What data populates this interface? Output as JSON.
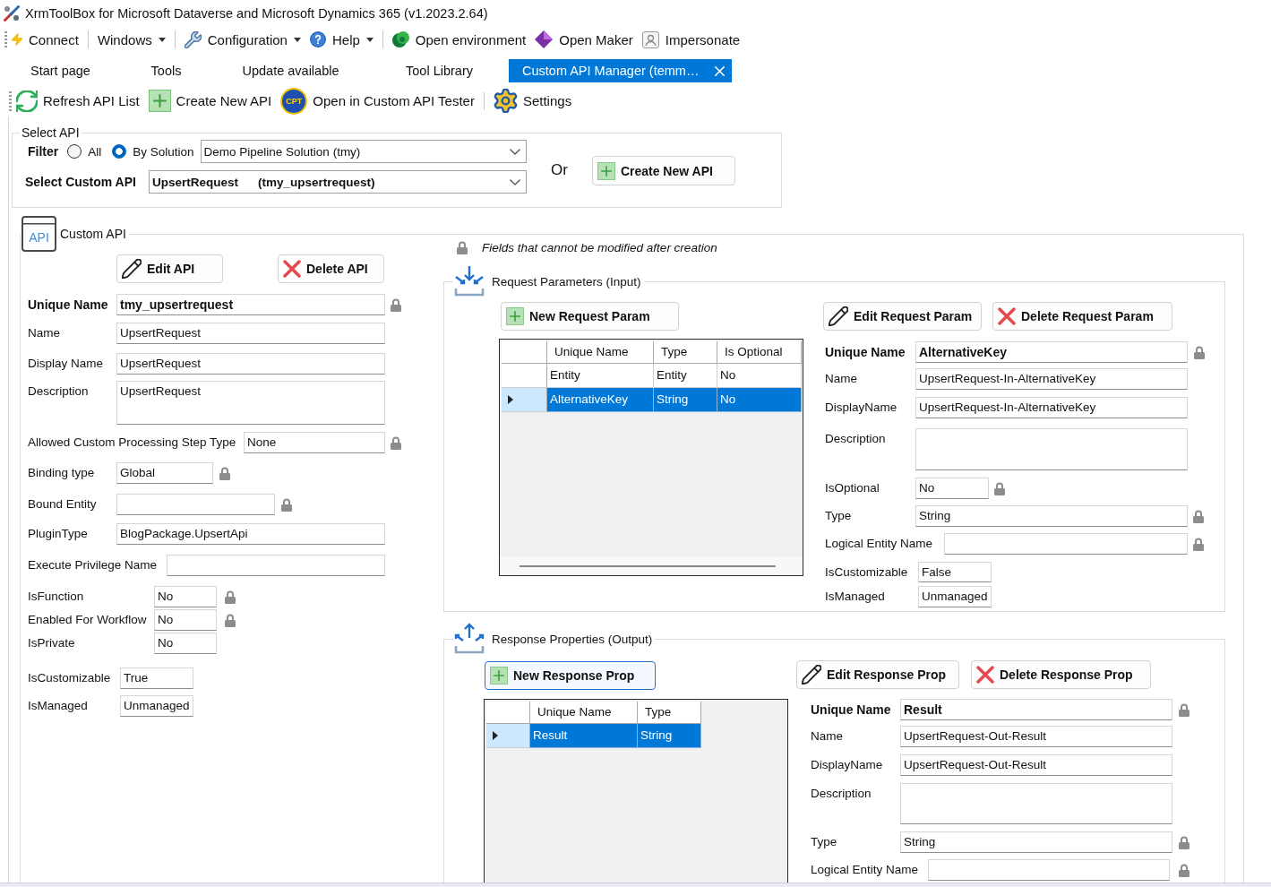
{
  "window": {
    "title": "XrmToolBox for Microsoft Dataverse and Microsoft Dynamics 365 (v1.2023.2.64)"
  },
  "menu_bar": {
    "groups": [
      {
        "items": [
          {
            "label": "Connect",
            "dropdown": false
          }
        ]
      },
      {
        "items": [
          {
            "label": "Windows",
            "dropdown": true
          }
        ]
      },
      {
        "items": [
          {
            "label": "Configuration",
            "dropdown": true
          },
          {
            "label": "Help",
            "dropdown": true
          }
        ]
      },
      {
        "items": [
          {
            "label": "Open environment",
            "dropdown": false
          },
          {
            "label": "Open Maker",
            "dropdown": false
          },
          {
            "label": "Impersonate",
            "dropdown": false
          }
        ]
      }
    ]
  },
  "tabs": [
    {
      "label": "Start page",
      "selected": false,
      "closable": false
    },
    {
      "label": "Tools",
      "selected": false,
      "closable": false
    },
    {
      "label": "Update available",
      "selected": false,
      "closable": false
    },
    {
      "label": "Tool Library",
      "selected": false,
      "closable": false
    },
    {
      "label": "Custom API Manager (temm…",
      "selected": true,
      "closable": true
    }
  ],
  "toolbar": {
    "groups": [
      {
        "items": [
          {
            "label": "Refresh API List"
          },
          {
            "label": "Create New API"
          },
          {
            "label": "Open in Custom API Tester",
            "logo_text": "CPT"
          }
        ]
      },
      {
        "items": [
          {
            "label": "Settings"
          }
        ]
      }
    ]
  },
  "select_api": {
    "title": "Select API",
    "filter": {
      "label": "Filter",
      "options": [
        {
          "label": "All",
          "selected": false
        },
        {
          "label": "By Solution",
          "selected": true
        }
      ],
      "solution": "Demo Pipeline Solution (tmy)"
    },
    "custom_api": {
      "label": "Select Custom API",
      "name": "UpsertRequest",
      "unique_name": "(tmy_upsertrequest)"
    },
    "or_label": "Or",
    "create_button": {
      "label": "Create New API",
      "kind": "new"
    }
  },
  "custom_api": {
    "title": "Custom API",
    "icon_text": "API",
    "buttons": [
      {
        "label": "Edit API",
        "kind": "edit"
      },
      {
        "label": "Delete API",
        "kind": "delete"
      }
    ],
    "fields": [
      {
        "kind": "key",
        "label": "Unique Name",
        "value": "tmy_upsertrequest",
        "locked": true
      },
      {
        "kind": "text",
        "label": "Name",
        "value": "UpsertRequest",
        "locked": false
      },
      {
        "kind": "text",
        "label": "Display Name",
        "value": "UpsertRequest",
        "locked": false
      },
      {
        "kind": "multiline",
        "label": "Description",
        "value": "UpsertRequest",
        "locked": false
      },
      {
        "kind": "text",
        "label": "Allowed Custom Processing Step Type",
        "value": "None",
        "locked": true
      },
      {
        "kind": "text",
        "label": "Binding type",
        "value": "Global",
        "locked": true
      },
      {
        "kind": "text",
        "label": "Bound Entity",
        "locked": true
      },
      {
        "kind": "text",
        "label": "PluginType",
        "value": "BlogPackage.UpsertApi",
        "locked": false
      },
      {
        "kind": "text",
        "label": "Execute Privilege Name",
        "locked": false
      },
      {
        "kind": "text",
        "label": "IsFunction",
        "value": "No",
        "locked": true
      },
      {
        "kind": "text",
        "label": "Enabled For Workflow",
        "value": "No",
        "locked": true
      },
      {
        "kind": "text",
        "label": "IsPrivate",
        "value": "No",
        "locked": false
      },
      {
        "kind": "text",
        "label": "IsCustomizable",
        "value": "True",
        "locked": false
      },
      {
        "kind": "text",
        "label": "IsManaged",
        "value": "Unmanaged",
        "locked": false
      }
    ],
    "locked_note": "Fields that cannot be modified after creation"
  },
  "request_parameters": {
    "title": "Request Parameters (Input)",
    "buttons": [
      {
        "label": "New Request Param",
        "kind": "new",
        "focused": false
      },
      {
        "label": "Edit Request Param",
        "kind": "edit",
        "focused": false
      },
      {
        "label": "Delete Request Param",
        "kind": "delete",
        "focused": false
      }
    ],
    "table": {
      "columns": [
        "Unique Name",
        "Type",
        "Is Optional"
      ],
      "rows": [
        {
          "cells": [
            "Entity",
            "Entity",
            "No"
          ],
          "selected": false
        },
        {
          "cells": [
            "AlternativeKey",
            "String",
            "No"
          ],
          "selected": true
        }
      ]
    },
    "fields": [
      {
        "kind": "key",
        "label": "Unique Name",
        "value": "AlternativeKey",
        "locked": true
      },
      {
        "kind": "text",
        "label": "Name",
        "value": "UpsertRequest-In-AlternativeKey",
        "locked": false
      },
      {
        "kind": "text",
        "label": "DisplayName",
        "value": "UpsertRequest-In-AlternativeKey",
        "locked": false
      },
      {
        "kind": "multiline",
        "label": "Description",
        "locked": false
      },
      {
        "kind": "text",
        "label": "IsOptional",
        "value": "No",
        "locked": true
      },
      {
        "kind": "text",
        "label": "Type",
        "value": "String",
        "locked": true
      },
      {
        "kind": "text",
        "label": "Logical Entity Name",
        "locked": true
      },
      {
        "kind": "text",
        "label": "IsCustomizable",
        "value": "False",
        "locked": false
      },
      {
        "kind": "text",
        "label": "IsManaged",
        "value": "Unmanaged",
        "locked": false
      }
    ]
  },
  "response_properties": {
    "title": "Response Properties (Output)",
    "buttons": [
      {
        "label": "New Response Prop",
        "kind": "new",
        "focused": true
      },
      {
        "label": "Edit Response Prop",
        "kind": "edit",
        "focused": false
      },
      {
        "label": "Delete Response Prop",
        "kind": "delete",
        "focused": false
      }
    ],
    "table": {
      "columns": [
        "Unique Name",
        "Type"
      ],
      "rows": [
        {
          "cells": [
            "Result",
            "String"
          ],
          "selected": true
        }
      ]
    },
    "fields": [
      {
        "kind": "key",
        "label": "Unique Name",
        "value": "Result",
        "locked": true
      },
      {
        "kind": "text",
        "label": "Name",
        "value": "UpsertRequest-Out-Result",
        "locked": false
      },
      {
        "kind": "text",
        "label": "DisplayName",
        "value": "UpsertRequest-Out-Result",
        "locked": false
      },
      {
        "kind": "multiline",
        "label": "Description",
        "locked": false
      },
      {
        "kind": "text",
        "label": "Type",
        "value": "String",
        "locked": true
      },
      {
        "kind": "text",
        "label": "Logical Entity Name",
        "locked": true
      }
    ]
  }
}
